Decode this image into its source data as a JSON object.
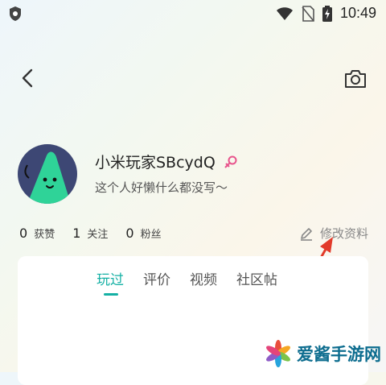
{
  "status_bar": {
    "time": "10:49",
    "icons": [
      "shield-icon",
      "wifi-icon",
      "no-sim-icon",
      "battery-charging-icon"
    ]
  },
  "header": {
    "back_icon": "chevron-left-icon",
    "camera_icon": "camera-icon"
  },
  "profile": {
    "username": "小米玩家SBcydQ",
    "gender_icon": "female-icon",
    "bio": "这个人好懒什么都没写～",
    "stats": [
      {
        "count": "0",
        "label": "获赞"
      },
      {
        "count": "1",
        "label": "关注"
      },
      {
        "count": "0",
        "label": "粉丝"
      }
    ],
    "edit_label": "修改资料"
  },
  "tabs": {
    "items": [
      {
        "label": "玩过",
        "active": true
      },
      {
        "label": "评价",
        "active": false
      },
      {
        "label": "视频",
        "active": false
      },
      {
        "label": "社区帖",
        "active": false
      }
    ]
  },
  "watermark": {
    "text": "爱酱手游网"
  },
  "colors": {
    "accent": "#14b0a4",
    "avatar_bg": "#3d4774",
    "avatar_figure": "#2fd398",
    "annotation_arrow": "#e23a2a",
    "female_icon": "#e8548c"
  }
}
